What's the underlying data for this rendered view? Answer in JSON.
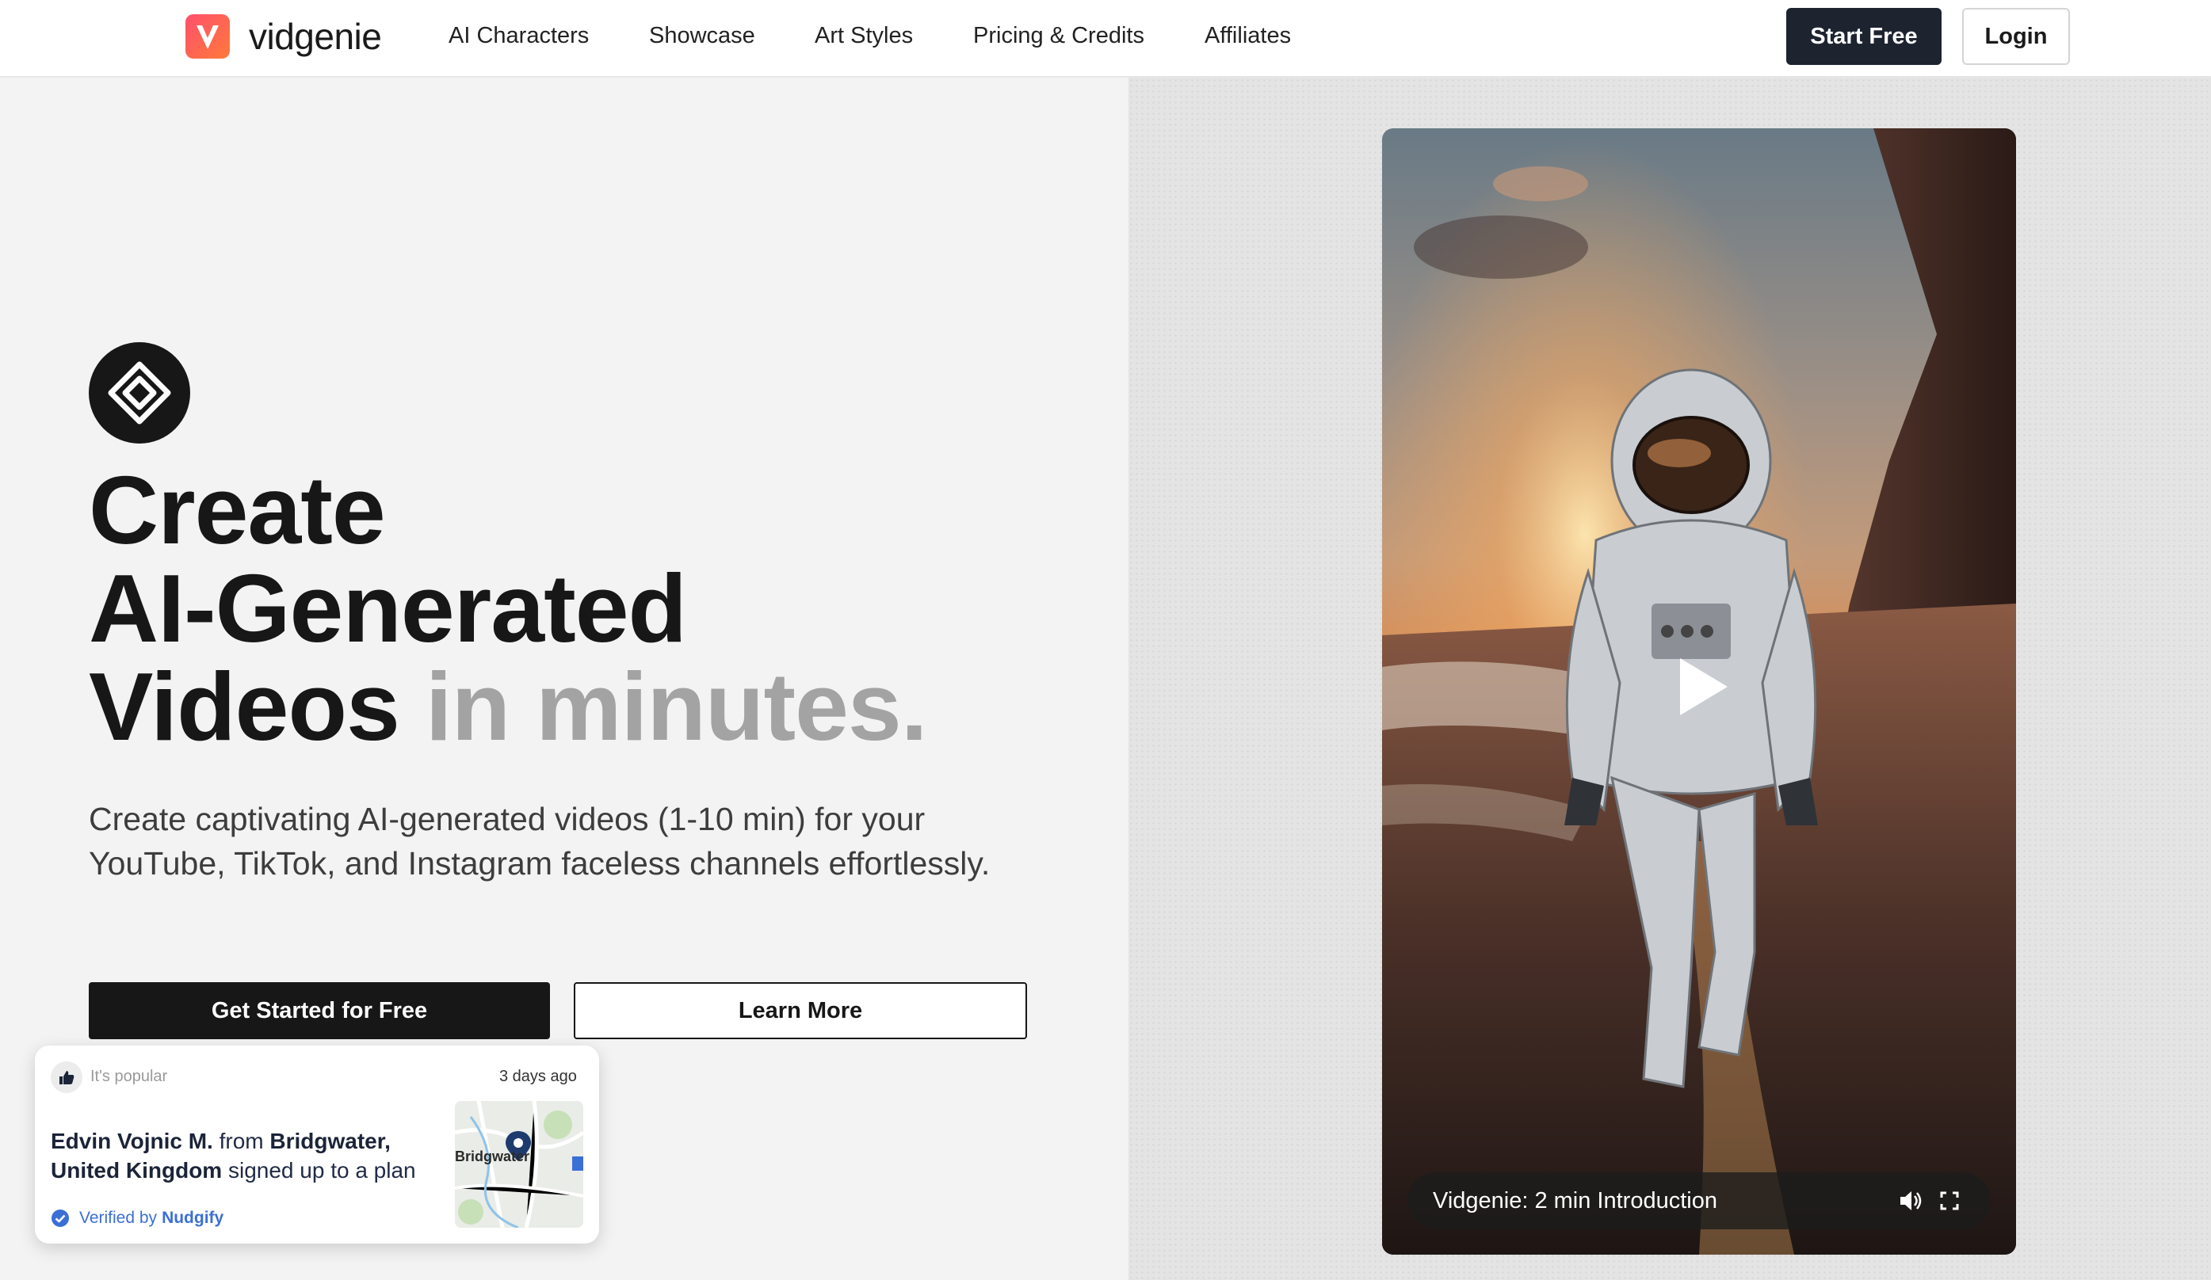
{
  "nav": {
    "brand": "vidgenie",
    "logo_letter": "V",
    "links": [
      "AI Characters",
      "Showcase",
      "Art Styles",
      "Pricing & Credits",
      "Affiliates"
    ],
    "start_label": "Start Free",
    "login_label": "Login"
  },
  "hero": {
    "title_line1": "Create",
    "title_line2": "AI-Generated",
    "title_line3_main": "Videos",
    "title_line3_muted": "in minutes.",
    "subtitle": "Create captivating AI-generated videos (1-10 min) for your YouTube, TikTok, and Instagram faceless channels effortlessly.",
    "primary_cta": "Get Started for Free",
    "secondary_cta": "Learn More"
  },
  "video": {
    "title": "Vidgenie: 2 min Introduction",
    "icons": [
      "play-icon",
      "volume-icon",
      "fullscreen-icon"
    ]
  },
  "notification": {
    "tag": "It's popular",
    "time": "3 days ago",
    "name": "Edvin Vojnic M.",
    "from_word": "from",
    "place": "Bridgwater, United Kingdom",
    "action": "signed up to a plan",
    "map_label": "Bridgwater",
    "verified_label": "Verified by",
    "verified_brand": "Nudgify"
  },
  "colors": {
    "dark_button": "#171717",
    "nav_start_button": "#1d2430",
    "brand_gradient_start": "#ff4f6d",
    "brand_gradient_end": "#ff7a3a",
    "muted_title": "#a3a3a3",
    "verified_blue": "#3b6fd6"
  }
}
